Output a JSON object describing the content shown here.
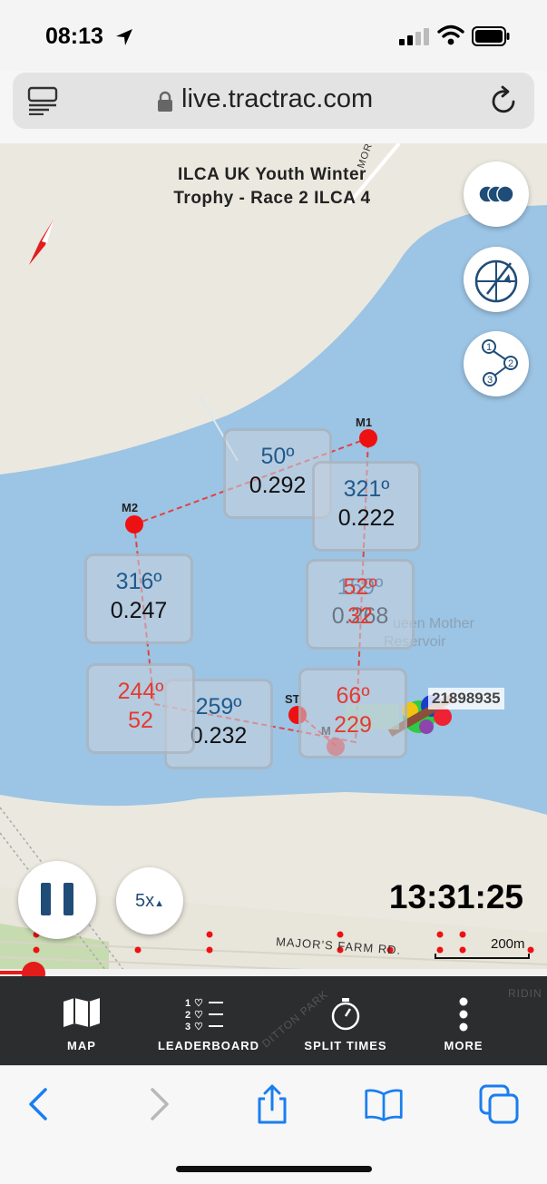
{
  "status_bar": {
    "time": "08:13"
  },
  "browser": {
    "url": "live.tractrac.com"
  },
  "race": {
    "title_line1": "ILCA UK Youth Winter",
    "title_line2": "Trophy - Race 2 ILCA 4"
  },
  "map": {
    "marks": [
      "M1",
      "M2",
      "ST",
      "M"
    ],
    "legs": [
      {
        "angle": "50º",
        "value": "0.292",
        "style": "blue"
      },
      {
        "angle": "321º",
        "value": "0.222",
        "style": "blue"
      },
      {
        "angle": "316º",
        "value": "0.247",
        "style": "blue"
      },
      {
        "angle": "52º",
        "value": "32",
        "style": "red"
      },
      {
        "angle": "159º",
        "value": "0.268",
        "style": "blue"
      },
      {
        "angle": "244º",
        "value": "52",
        "style": "red"
      },
      {
        "angle": "259º",
        "value": "0.232",
        "style": "blue"
      },
      {
        "angle": "66º",
        "value": "229",
        "style": "red"
      }
    ],
    "boat_label": "21898935",
    "reservoir_label_line1": "ueen Mother",
    "reservoir_label_line2": "Reservoir",
    "road_labels": [
      "MAJOR'S FARM RD.",
      "DITTON PARK",
      "RIDIN",
      "MORTON R"
    ],
    "scale": "200m"
  },
  "playback": {
    "speed": "5x",
    "clock": "13:31:25",
    "progress_fraction": 0.06
  },
  "tabs": [
    {
      "label": "MAP",
      "icon": "map-icon"
    },
    {
      "label": "LEADERBOARD",
      "icon": "leaderboard-icon"
    },
    {
      "label": "SPLIT TIMES",
      "icon": "stopwatch-icon"
    },
    {
      "label": "MORE",
      "icon": "more-icon"
    }
  ],
  "colors": {
    "water": "#9cc4e4",
    "land": "#ebe8df",
    "mark": "#ee1111",
    "accent": "#1f4d78",
    "tabbar": "#2b2d2f"
  }
}
